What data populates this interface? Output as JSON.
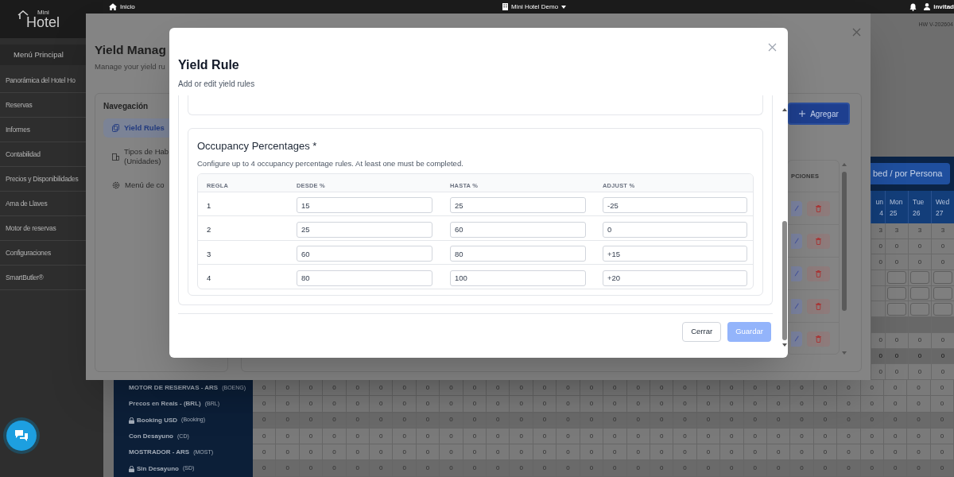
{
  "topbar": {
    "home": "Inicio",
    "hotel": "Mini Hotel Demo",
    "user": "invitad"
  },
  "logo": {
    "small": "Mini",
    "large": "Hotel"
  },
  "sidebar": {
    "header": "Menú Principal",
    "items": [
      {
        "label": "Panorámica del Hotel Ho"
      },
      {
        "label": "Reservas"
      },
      {
        "label": "Informes"
      },
      {
        "label": "Contabilidad"
      },
      {
        "label": "Precios y Disponibilidades"
      },
      {
        "label": "Ama de Llaves"
      },
      {
        "label": "Motor de reservas"
      },
      {
        "label": "Configuraciones"
      },
      {
        "label": "SmartButler®"
      }
    ]
  },
  "version": "HW V-202604",
  "rates_table": {
    "view_button": "bed / por Persona",
    "days": [
      {
        "day": "un",
        "date": "4"
      },
      {
        "day": "Mon",
        "date": "25"
      },
      {
        "day": "Tue",
        "date": "26"
      },
      {
        "day": "Wed",
        "date": "27"
      }
    ],
    "upper_rows": [
      {
        "kind": "value",
        "shaded": false,
        "values": [
          "3",
          "3",
          "3",
          "3"
        ]
      },
      {
        "kind": "value",
        "shaded": false,
        "values": [
          "0",
          "0",
          "0",
          "0"
        ]
      },
      {
        "kind": "value",
        "shaded": false,
        "values": [
          "0",
          "0",
          "0",
          "0"
        ]
      },
      {
        "kind": "input"
      },
      {
        "kind": "input"
      },
      {
        "kind": "input"
      },
      {
        "kind": "blank"
      },
      {
        "kind": "value",
        "shaded": false,
        "values": [
          "0",
          "0",
          "0",
          "0"
        ]
      },
      {
        "kind": "value",
        "shaded": true,
        "values": [
          "0",
          "0",
          "0",
          "0"
        ]
      },
      {
        "kind": "value",
        "shaded": false,
        "values": [
          "0",
          "0",
          "0",
          "0"
        ]
      }
    ],
    "rows": [
      {
        "label": "MOTOR DE RESERVAS - ARS",
        "code": "(BOENG)",
        "locked": false,
        "values": [
          "0",
          "0",
          "0",
          "0",
          "0",
          "0",
          "0",
          "0",
          "0",
          "0",
          "0",
          "0",
          "0",
          "0",
          "0",
          "0",
          "0",
          "0",
          "0",
          "0",
          "0",
          "0",
          "0",
          "0",
          "0",
          "0",
          "0",
          "0",
          "0",
          "0"
        ]
      },
      {
        "label": "Precos en Reais - (BRL)",
        "code": "(BRL)",
        "locked": false,
        "values": [
          "0",
          "0",
          "0",
          "0",
          "0",
          "0",
          "0",
          "0",
          "0",
          "0",
          "0",
          "0",
          "0",
          "0",
          "0",
          "0",
          "0",
          "0",
          "0",
          "0",
          "0",
          "0",
          "0",
          "0",
          "0",
          "0",
          "0",
          "0",
          "0",
          "0"
        ]
      },
      {
        "label": "Booking USD",
        "code": "(Booking)",
        "locked": true,
        "values": [
          "0",
          "0",
          "0",
          "0",
          "0",
          "0",
          "0",
          "0",
          "0",
          "0",
          "0",
          "0",
          "0",
          "0",
          "0",
          "0",
          "0",
          "0",
          "0",
          "0",
          "0",
          "0",
          "0",
          "0",
          "0",
          "0",
          "0",
          "0",
          "0",
          "0"
        ]
      },
      {
        "label": "Con Desayuno",
        "code": "(CD)",
        "locked": false,
        "values": [
          "0",
          "0",
          "0",
          "0",
          "0",
          "0",
          "0",
          "0",
          "0",
          "0",
          "0",
          "0",
          "0",
          "0",
          "0",
          "0",
          "0",
          "0",
          "0",
          "0",
          "0",
          "0",
          "0",
          "0",
          "0",
          "0",
          "0",
          "0",
          "0",
          "0"
        ]
      },
      {
        "label": "MOSTRADOR - ARS",
        "code": "(MOST)",
        "locked": false,
        "values": [
          "0",
          "0",
          "0",
          "0",
          "0",
          "0",
          "0",
          "0",
          "0",
          "0",
          "0",
          "0",
          "0",
          "0",
          "0",
          "0",
          "0",
          "0",
          "0",
          "0",
          "0",
          "0",
          "0",
          "0",
          "0",
          "0",
          "0",
          "0",
          "0",
          "0"
        ]
      },
      {
        "label": "Sin Desayuno",
        "code": "(SD)",
        "locked": true,
        "values": [
          "0",
          "0",
          "0",
          "0",
          "0",
          "0",
          "0",
          "0",
          "0",
          "0",
          "0",
          "0",
          "0",
          "0",
          "0",
          "0",
          "0",
          "0",
          "0",
          "0",
          "0",
          "0",
          "0",
          "0",
          "0",
          "0",
          "0",
          "0",
          "0",
          "0"
        ]
      }
    ]
  },
  "yield_management": {
    "title": "Yield Manag",
    "subtitle": "Manage your yield ru",
    "nav_title": "Navegación",
    "nav_items": [
      {
        "lines": [
          "Yield Rules"
        ],
        "selected": true
      },
      {
        "lines": [
          "Tipos de Hab",
          "(Unidades)"
        ],
        "selected": false
      },
      {
        "lines": [
          "Menú de co"
        ],
        "selected": false
      }
    ],
    "add_button": "Agregar",
    "options_header": "PCIONES",
    "option_rows": [
      {
        "kind": "actions"
      },
      {
        "kind": "actions"
      },
      {
        "kind": "actions"
      },
      {
        "kind": "actions"
      },
      {
        "kind": "actions"
      }
    ]
  },
  "yield_rule": {
    "title": "Yield Rule",
    "subtitle": "Add or edit yield rules",
    "section": {
      "title": "Occupancy Percentages *",
      "hint": "Configure up to 4 occupancy percentage rules. At least one must be completed.",
      "columns": [
        "REGLA",
        "DESDE %",
        "HASTA %",
        "ADJUST %"
      ],
      "rows": [
        {
          "rule": "1",
          "from": "15",
          "to": "25",
          "adjust": "-25"
        },
        {
          "rule": "2",
          "from": "25",
          "to": "60",
          "adjust": "0"
        },
        {
          "rule": "3",
          "from": "60",
          "to": "80",
          "adjust": "+15"
        },
        {
          "rule": "4",
          "from": "80",
          "to": "100",
          "adjust": "+20"
        }
      ]
    },
    "buttons": [
      {
        "label": "Cerrar",
        "kind": "secondary",
        "disabled": false
      },
      {
        "label": "Guardar",
        "kind": "primary",
        "disabled": true
      }
    ]
  }
}
